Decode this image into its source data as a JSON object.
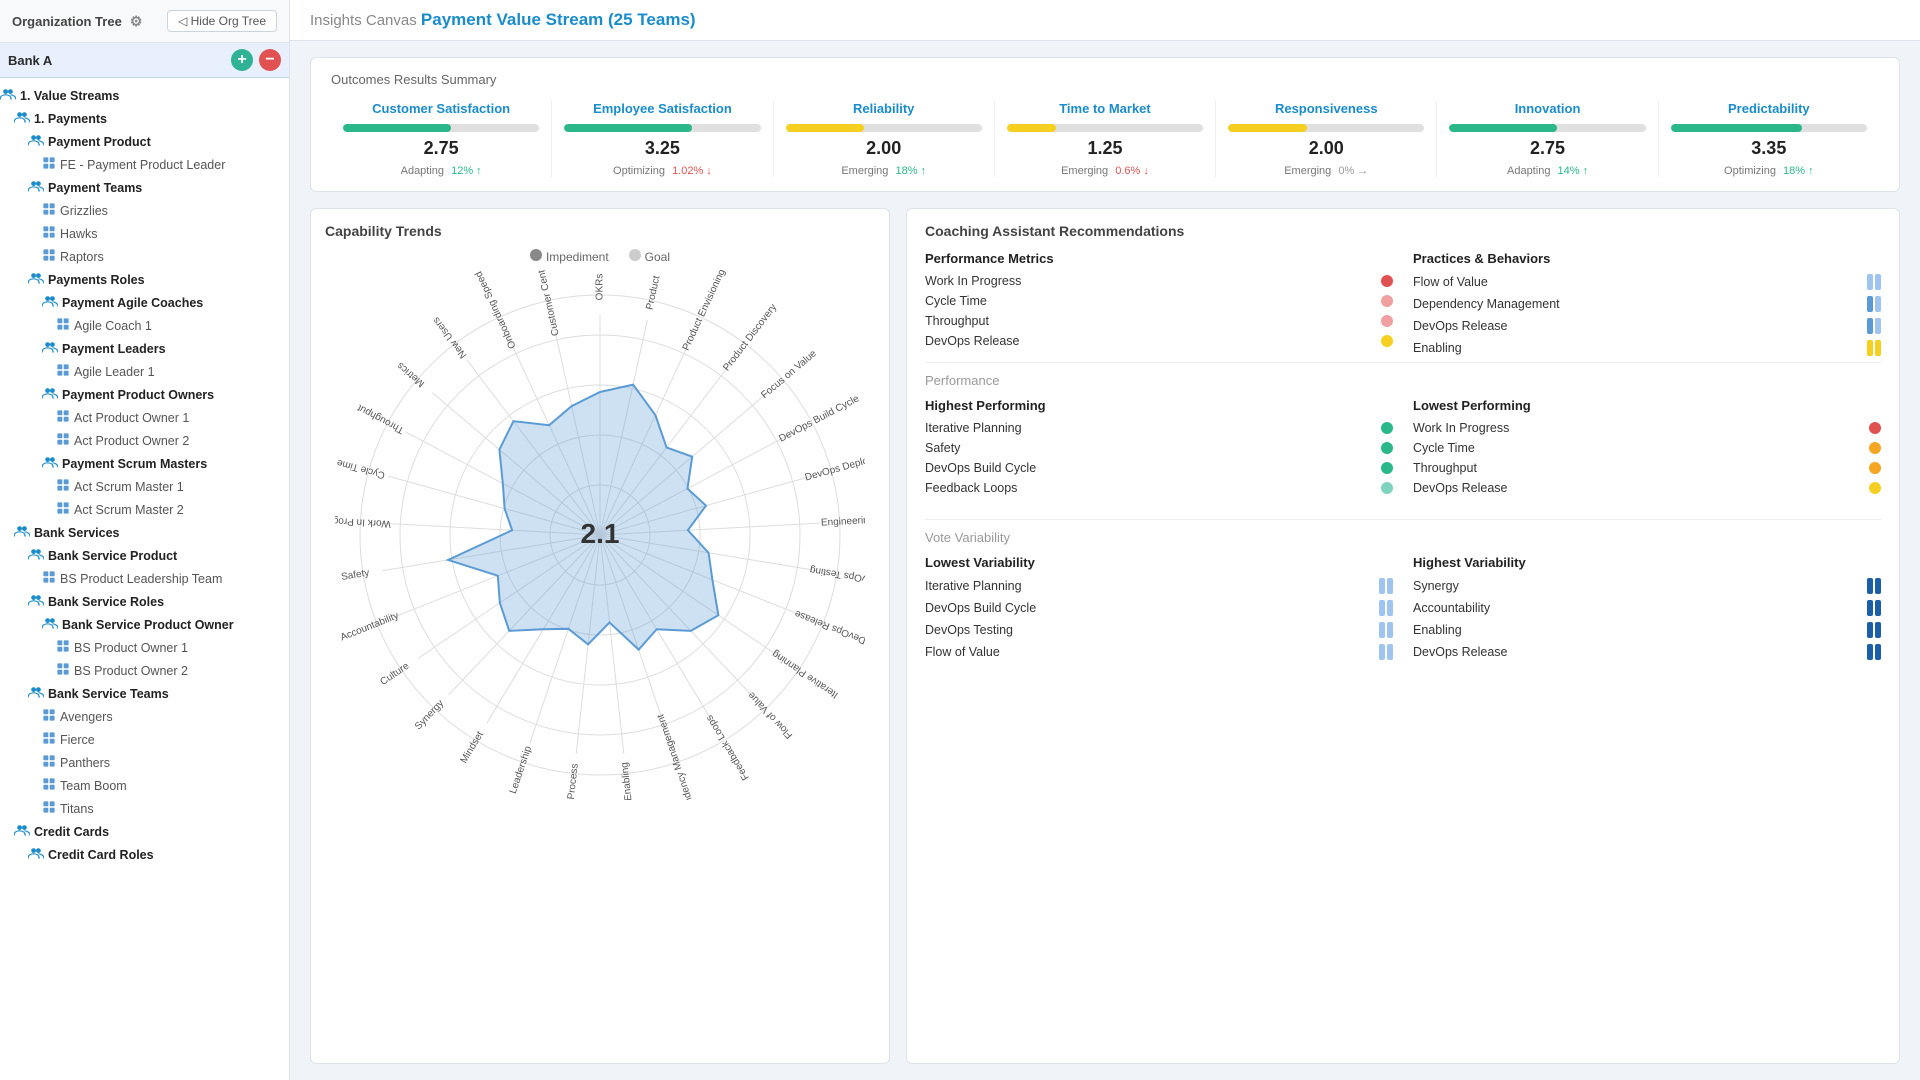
{
  "sidebar": {
    "title": "Organization Tree",
    "org_label": "Bank A",
    "hide_btn": "◁ Hide Org Tree",
    "tree": [
      {
        "id": "value-streams",
        "label": "1. Value Streams",
        "indent": 0,
        "bold": true,
        "icon": "people"
      },
      {
        "id": "payments",
        "label": "1. Payments",
        "indent": 1,
        "bold": true,
        "icon": "people"
      },
      {
        "id": "payment-product",
        "label": "Payment Product",
        "indent": 2,
        "bold": true,
        "icon": "people"
      },
      {
        "id": "fe-payment",
        "label": "FE - Payment Product Leader",
        "indent": 3,
        "bold": false,
        "icon": "person"
      },
      {
        "id": "payment-teams",
        "label": "Payment Teams",
        "indent": 2,
        "bold": true,
        "icon": "people"
      },
      {
        "id": "grizzlies",
        "label": "Grizzlies",
        "indent": 3,
        "bold": false,
        "icon": "person"
      },
      {
        "id": "hawks",
        "label": "Hawks",
        "indent": 3,
        "bold": false,
        "icon": "person"
      },
      {
        "id": "raptors",
        "label": "Raptors",
        "indent": 3,
        "bold": false,
        "icon": "person"
      },
      {
        "id": "payment-roles",
        "label": "Payments Roles",
        "indent": 2,
        "bold": true,
        "icon": "people"
      },
      {
        "id": "payment-agile-coaches",
        "label": "Payment Agile Coaches",
        "indent": 3,
        "bold": true,
        "icon": "people"
      },
      {
        "id": "agile-coach-1",
        "label": "Agile Coach 1",
        "indent": 4,
        "bold": false,
        "icon": "person"
      },
      {
        "id": "payment-leaders",
        "label": "Payment Leaders",
        "indent": 3,
        "bold": true,
        "icon": "people"
      },
      {
        "id": "agile-leader-1",
        "label": "Agile Leader 1",
        "indent": 4,
        "bold": false,
        "icon": "person"
      },
      {
        "id": "payment-product-owners",
        "label": "Payment Product Owners",
        "indent": 3,
        "bold": true,
        "icon": "people"
      },
      {
        "id": "act-product-owner-1",
        "label": "Act Product Owner 1",
        "indent": 4,
        "bold": false,
        "icon": "person"
      },
      {
        "id": "act-product-owner-2",
        "label": "Act Product Owner 2",
        "indent": 4,
        "bold": false,
        "icon": "person"
      },
      {
        "id": "payment-scrum-masters",
        "label": "Payment Scrum Masters",
        "indent": 3,
        "bold": true,
        "icon": "people"
      },
      {
        "id": "act-scrum-master-1",
        "label": "Act Scrum Master 1",
        "indent": 4,
        "bold": false,
        "icon": "person"
      },
      {
        "id": "act-scrum-master-2",
        "label": "Act Scrum Master 2",
        "indent": 4,
        "bold": false,
        "icon": "person"
      },
      {
        "id": "bank-services",
        "label": "Bank Services",
        "indent": 1,
        "bold": true,
        "icon": "people"
      },
      {
        "id": "bank-service-product",
        "label": "Bank Service Product",
        "indent": 2,
        "bold": true,
        "icon": "people"
      },
      {
        "id": "bs-product-leadership",
        "label": "BS Product Leadership Team",
        "indent": 3,
        "bold": false,
        "icon": "person"
      },
      {
        "id": "bank-service-roles",
        "label": "Bank Service Roles",
        "indent": 2,
        "bold": true,
        "icon": "people"
      },
      {
        "id": "bank-service-product-owners",
        "label": "Bank Service Product Owner",
        "indent": 3,
        "bold": true,
        "icon": "people"
      },
      {
        "id": "bs-product-owner-1",
        "label": "BS Product Owner 1",
        "indent": 4,
        "bold": false,
        "icon": "person"
      },
      {
        "id": "bs-product-owner-2",
        "label": "BS Product Owner 2",
        "indent": 4,
        "bold": false,
        "icon": "person"
      },
      {
        "id": "bank-service-teams",
        "label": "Bank Service Teams",
        "indent": 2,
        "bold": true,
        "icon": "people"
      },
      {
        "id": "avengers",
        "label": "Avengers",
        "indent": 3,
        "bold": false,
        "icon": "person"
      },
      {
        "id": "fierce",
        "label": "Fierce",
        "indent": 3,
        "bold": false,
        "icon": "person"
      },
      {
        "id": "panthers",
        "label": "Panthers",
        "indent": 3,
        "bold": false,
        "icon": "person"
      },
      {
        "id": "team-boom",
        "label": "Team Boom",
        "indent": 3,
        "bold": false,
        "icon": "person"
      },
      {
        "id": "titans",
        "label": "Titans",
        "indent": 3,
        "bold": false,
        "icon": "person"
      },
      {
        "id": "credit-cards",
        "label": "Credit Cards",
        "indent": 1,
        "bold": true,
        "icon": "people"
      },
      {
        "id": "credit-card-roles",
        "label": "Credit Card Roles",
        "indent": 2,
        "bold": true,
        "icon": "people"
      }
    ]
  },
  "topbar": {
    "breadcrumb_prefix": "Insights Canvas",
    "title": "Payment Value Stream (25 Teams)"
  },
  "outcomes": {
    "section_title": "Outcomes Results Summary",
    "items": [
      {
        "label": "Customer Satisfaction",
        "value": "2.75",
        "status": "Adapting",
        "pct": "12%",
        "direction": "up",
        "fill_pct": 55,
        "color": "#2ab88a"
      },
      {
        "label": "Employee Satisfaction",
        "value": "3.25",
        "status": "Optimizing",
        "pct": "1.02%",
        "direction": "down",
        "fill_pct": 65,
        "color": "#2ab88a"
      },
      {
        "label": "Reliability",
        "value": "2.00",
        "status": "Emerging",
        "pct": "18%",
        "direction": "up",
        "fill_pct": 40,
        "color": "#f5d020"
      },
      {
        "label": "Time to Market",
        "value": "1.25",
        "status": "Emerging",
        "pct": "0.6%",
        "direction": "down",
        "fill_pct": 25,
        "color": "#f5d020"
      },
      {
        "label": "Responsiveness",
        "value": "2.00",
        "status": "Emerging",
        "pct": "0%",
        "direction": "right",
        "fill_pct": 40,
        "color": "#f5d020"
      },
      {
        "label": "Innovation",
        "value": "2.75",
        "status": "Adapting",
        "pct": "14%",
        "direction": "up",
        "fill_pct": 55,
        "color": "#2ab88a"
      },
      {
        "label": "Predictability",
        "value": "3.35",
        "status": "Optimizing",
        "pct": "18%",
        "direction": "up",
        "fill_pct": 67,
        "color": "#2ab88a"
      }
    ]
  },
  "capability_trends": {
    "section_title": "Capability Trends",
    "legend": [
      {
        "label": "Impediment",
        "color": "#888"
      },
      {
        "label": "Goal",
        "color": "#ccc"
      }
    ],
    "center_value": "2.1",
    "radar_labels": [
      "OKRs",
      "Product",
      "Product Envisioning",
      "Product Discovery",
      "Focus on Value",
      "DevOps Build Cycle",
      "DevOps Deploy",
      "Engineering",
      "DevOps Testing",
      "DevOps Release",
      "Iterative Planning",
      "Flow of Value",
      "Feedback Loops",
      "Dependency Management",
      "Enabling",
      "Process",
      "Leadership",
      "Mindset",
      "Synergy",
      "Culture",
      "Accountability",
      "Safety",
      "Work In Progress",
      "Cycle Time",
      "Throughput",
      "Metrics",
      "New Users",
      "Onboarding Speed",
      "Customer Centricity"
    ]
  },
  "coaching": {
    "section_title": "Coaching Assistant Recommendations",
    "performance_metrics": {
      "header": "Performance Metrics",
      "items": [
        {
          "name": "Work In Progress",
          "dot_class": "dot-red"
        },
        {
          "name": "Cycle Time",
          "dot_class": "dot-pink"
        },
        {
          "name": "Throughput",
          "dot_class": "dot-pink"
        },
        {
          "name": "DevOps Release",
          "dot_class": "dot-yellow"
        }
      ]
    },
    "practices_behaviors": {
      "header": "Practices & Behaviors",
      "items": [
        {
          "name": "Flow of Value",
          "bars": [
            "bar-light-blue",
            "bar-light-blue"
          ]
        },
        {
          "name": "Dependency Management",
          "bars": [
            "bar-blue",
            "bar-light-blue"
          ]
        },
        {
          "name": "DevOps Release",
          "bars": [
            "bar-blue",
            "bar-light-blue"
          ]
        },
        {
          "name": "Enabling",
          "bars": [
            "bar-yellow",
            "bar-yellow"
          ]
        }
      ]
    },
    "performance_section": {
      "title": "Performance",
      "highest": {
        "header": "Highest Performing",
        "items": [
          {
            "name": "Iterative Planning",
            "dot_class": "dot-teal"
          },
          {
            "name": "Safety",
            "dot_class": "dot-teal"
          },
          {
            "name": "DevOps Build Cycle",
            "dot_class": "dot-teal"
          },
          {
            "name": "Feedback Loops",
            "dot_class": "dot-light-teal"
          }
        ]
      },
      "lowest": {
        "header": "Lowest Performing",
        "items": [
          {
            "name": "Work In Progress",
            "dot_class": "dot-red"
          },
          {
            "name": "Cycle Time",
            "dot_class": "dot-orange"
          },
          {
            "name": "Throughput",
            "dot_class": "dot-orange"
          },
          {
            "name": "DevOps Release",
            "dot_class": "dot-yellow"
          }
        ]
      }
    },
    "variability_section": {
      "title": "Vote Variability",
      "lowest": {
        "header": "Lowest Variability",
        "items": [
          {
            "name": "Iterative Planning",
            "bars": [
              "bar-light-blue",
              "bar-light-blue"
            ]
          },
          {
            "name": "DevOps Build Cycle",
            "bars": [
              "bar-light-blue",
              "bar-light-blue"
            ]
          },
          {
            "name": "DevOps Testing",
            "bars": [
              "bar-light-blue",
              "bar-light-blue"
            ]
          },
          {
            "name": "Flow of Value",
            "bars": [
              "bar-light-blue",
              "bar-light-blue"
            ]
          }
        ]
      },
      "highest": {
        "header": "Highest Variability",
        "items": [
          {
            "name": "Synergy",
            "bars": [
              "bar-dark-blue",
              "bar-dark-blue"
            ]
          },
          {
            "name": "Accountability",
            "bars": [
              "bar-dark-blue",
              "bar-dark-blue"
            ]
          },
          {
            "name": "Enabling",
            "bars": [
              "bar-dark-blue",
              "bar-dark-blue"
            ]
          },
          {
            "name": "DevOps Release",
            "bars": [
              "bar-dark-blue",
              "bar-dark-blue"
            ]
          }
        ]
      }
    }
  }
}
